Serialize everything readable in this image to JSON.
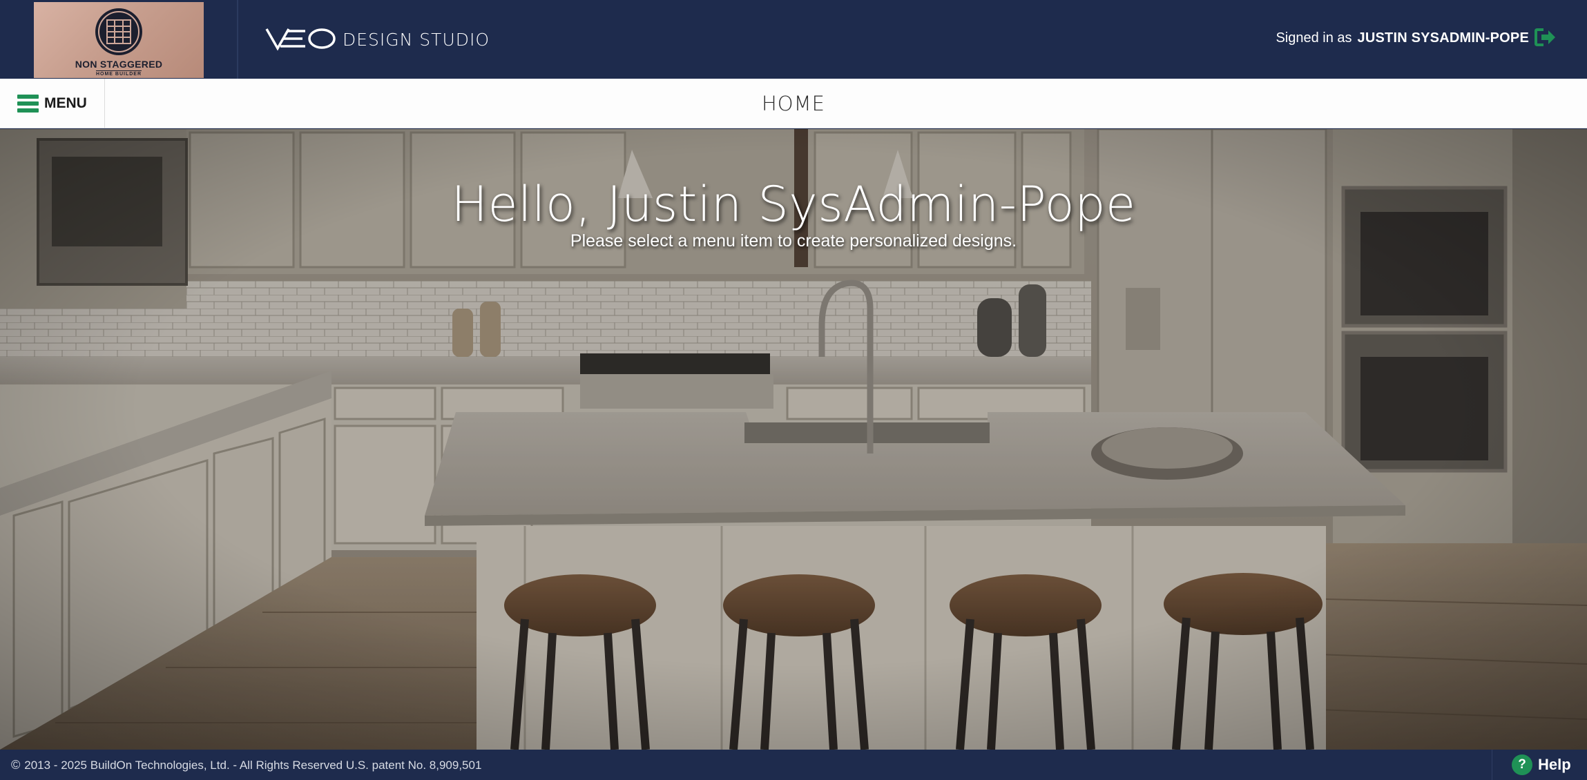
{
  "header": {
    "builder_logo": {
      "name": "NON STAGGERED",
      "subtitle": "HOME BUILDER"
    },
    "app_logo": {
      "mark": "VEO",
      "text": "DESIGN STUDIO"
    },
    "signed_in_prefix": "Signed in as",
    "user_name": "JUSTIN SYSADMIN-POPE",
    "signout_icon": "sign-out-icon"
  },
  "nav": {
    "menu_label": "MENU",
    "menu_icon": "hamburger-icon",
    "page_title": "HOME"
  },
  "hero": {
    "greeting": "Hello, Justin SysAdmin-Pope",
    "subtext": "Please select a menu item to create personalized designs."
  },
  "footer": {
    "copyright_symbol": "©",
    "copyright": "2013 - 2025 BuildOn Technologies, Ltd. - All Rights Reserved U.S. patent No. 8,909,501",
    "help_icon": "?",
    "help_label": "Help"
  },
  "colors": {
    "header_bg": "#1e2b4d",
    "accent_green": "#1f9156",
    "nav_bg": "#fdfdfd"
  }
}
